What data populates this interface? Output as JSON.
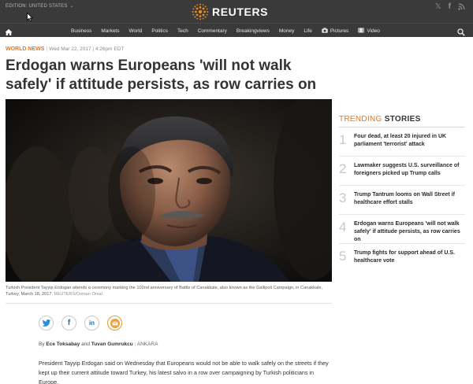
{
  "topbar": {
    "edition_label": "EDITION:  UNITED STATES",
    "logo_text": "REUTERS",
    "social_icons": [
      "twitter-icon",
      "facebook-icon",
      "rss-icon"
    ]
  },
  "nav": {
    "items": [
      {
        "label": "Business"
      },
      {
        "label": "Markets"
      },
      {
        "label": "World"
      },
      {
        "label": "Politics"
      },
      {
        "label": "Tech"
      },
      {
        "label": "Commentary"
      },
      {
        "label": "Breakingviews"
      },
      {
        "label": "Money"
      },
      {
        "label": "Life"
      },
      {
        "label": "Pictures",
        "icon": "camera-icon"
      },
      {
        "label": "Video",
        "icon": "video-icon"
      }
    ]
  },
  "article": {
    "section": "WORLD NEWS",
    "date": "Wed Mar 22, 2017 | 4:26pm EDT",
    "headline": "Erdogan warns Europeans 'will not walk safely' if attitude persists, as row carries on",
    "caption": "Turkish President Tayyip Erdogan attends a ceremony marking the 102nd anniversary of Battle of Canakkale, also known as the Gallipoli Campaign, in Canakkale, Turkey, March 18, 2017.",
    "caption_credit": "REUTERS/Osman Orsal",
    "byline_prefix": "By",
    "author1": "Ece Toksabay",
    "byline_and": "and",
    "author2": "Tuvan Gumrukcu",
    "location": "ANKARA",
    "body": "President Tayyip Erdogan said on Wednesday that Europeans would not be able to walk safely on the streets if they kept up their current attitude toward Turkey, his latest salvo in a row over campaigning by Turkish politicians in Europe."
  },
  "trending": {
    "title_part1": "TRENDING",
    "title_part2": "STORIES",
    "items": [
      {
        "num": "1",
        "text": "Four dead, at least 20 injured in UK parliament 'terrorist' attack"
      },
      {
        "num": "2",
        "text": "Lawmaker suggests U.S. surveillance of foreigners picked up Trump calls"
      },
      {
        "num": "3",
        "text": "Trump Tantrum looms on Wall Street if healthcare effort stalls"
      },
      {
        "num": "4",
        "text": "Erdogan warns Europeans 'will not walk safely' if attitude persists, as row carries on"
      },
      {
        "num": "5",
        "text": "Trump fights for support ahead of U.S. healthcare vote"
      }
    ]
  },
  "colors": {
    "header_bg": "#3a3a3a",
    "accent_orange": "#e8751a",
    "text_dark": "#333333"
  }
}
